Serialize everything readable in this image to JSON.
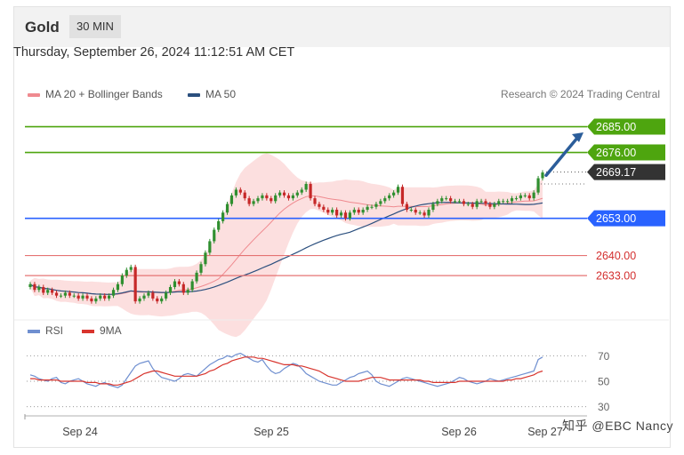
{
  "header": {
    "asset": "Gold",
    "timeframe": "30 MIN"
  },
  "datetime": "Thursday, September 26, 2024 11:12:51 AM CET",
  "legend": [
    {
      "label": "MA 20 + Bollinger Bands",
      "color": "#ef8a8f"
    },
    {
      "label": "MA 50",
      "color": "#2b4f7e"
    }
  ],
  "credit": "Research © 2024 Trading Central",
  "rsi_legend": [
    {
      "label": "RSI",
      "color": "#6f8fd0"
    },
    {
      "label": "9MA",
      "color": "#d8342d"
    }
  ],
  "watermark": "知乎 @EBC Nancy",
  "colors": {
    "up": "#2f8f2f",
    "down": "#c62828",
    "resistance": "#4ea50f",
    "pivot": "#2962ff",
    "support": "#e57373",
    "last": "#333333"
  },
  "chart_data": [
    {
      "type": "candlestick",
      "title": "Gold",
      "timeframe": "30 MIN",
      "ylim": [
        2620,
        2692
      ],
      "x_ticks": [
        "Sep 24",
        "Sep 25",
        "Sep 26",
        "Sep 27"
      ],
      "last_price": 2669.17,
      "levels": [
        {
          "label": "2685.00",
          "value": 2685,
          "kind": "resistance"
        },
        {
          "label": "2676.00",
          "value": 2676,
          "kind": "resistance"
        },
        {
          "label": "2653.00",
          "value": 2653,
          "kind": "pivot"
        },
        {
          "label": "2640.00",
          "value": 2640,
          "kind": "support"
        },
        {
          "label": "2633.00",
          "value": 2633,
          "kind": "support"
        }
      ],
      "last_label": "2669.17",
      "projection": {
        "from": 2668,
        "to": 2683
      },
      "close": [
        2630,
        2628,
        2629,
        2627,
        2628,
        2627,
        2626,
        2626,
        2627,
        2626,
        2626,
        2625,
        2626,
        2625,
        2624,
        2625,
        2626,
        2625,
        2626,
        2628,
        2630,
        2633,
        2635,
        2636,
        2624,
        2625,
        2626,
        2627,
        2625,
        2624,
        2625,
        2627,
        2629,
        2631,
        2630,
        2627,
        2628,
        2631,
        2634,
        2637,
        2641,
        2645,
        2649,
        2652,
        2655,
        2658,
        2661,
        2663,
        2662,
        2660,
        2658,
        2659,
        2660,
        2661,
        2660,
        2659,
        2661,
        2662,
        2661,
        2660,
        2661,
        2662,
        2663,
        2665,
        2660,
        2658,
        2657,
        2656,
        2655,
        2656,
        2654,
        2655,
        2653,
        2655,
        2656,
        2655,
        2656,
        2657,
        2657,
        2658,
        2659,
        2660,
        2661,
        2662,
        2664,
        2658,
        2656,
        2656,
        2655,
        2655,
        2654,
        2656,
        2658,
        2659,
        2660,
        2660,
        2659,
        2659,
        2659,
        2658,
        2658,
        2657,
        2659,
        2659,
        2658,
        2657,
        2658,
        2659,
        2659,
        2659,
        2660,
        2660,
        2661,
        2661,
        2660,
        2662,
        2667,
        2669
      ]
    },
    {
      "type": "line",
      "title": "RSI",
      "ylim": [
        20,
        80
      ],
      "y_ticks": [
        70,
        50,
        30
      ],
      "series": [
        {
          "name": "RSI",
          "values": [
            55,
            54,
            52,
            51,
            50,
            52,
            53,
            49,
            48,
            50,
            51,
            52,
            50,
            48,
            47,
            46,
            48,
            49,
            47,
            46,
            45,
            47,
            52,
            57,
            62,
            64,
            65,
            66,
            60,
            56,
            53,
            52,
            51,
            50,
            52,
            55,
            56,
            55,
            54,
            57,
            60,
            63,
            65,
            67,
            68,
            70,
            69,
            71,
            72,
            70,
            68,
            66,
            65,
            67,
            62,
            58,
            56,
            57,
            60,
            62,
            64,
            63,
            60,
            56,
            54,
            52,
            50,
            49,
            48,
            47,
            47,
            49,
            51,
            53,
            54,
            56,
            57,
            58,
            55,
            50,
            48,
            47,
            46,
            48,
            50,
            52,
            53,
            52,
            51,
            50,
            49,
            48,
            47,
            46,
            47,
            48,
            49,
            51,
            53,
            52,
            50,
            49,
            48,
            49,
            50,
            52,
            51,
            50,
            51,
            52,
            53,
            54,
            55,
            56,
            57,
            58,
            67,
            69
          ]
        },
        {
          "name": "9MA",
          "values": [
            52,
            52,
            51,
            51,
            51,
            51,
            51,
            50,
            50,
            50,
            50,
            50,
            50,
            49,
            49,
            49,
            48,
            48,
            48,
            47,
            47,
            48,
            49,
            50,
            52,
            54,
            56,
            57,
            58,
            58,
            57,
            56,
            55,
            54,
            54,
            54,
            54,
            54,
            54,
            55,
            56,
            58,
            59,
            61,
            63,
            64,
            66,
            67,
            68,
            69,
            69,
            69,
            68,
            68,
            67,
            66,
            65,
            64,
            63,
            63,
            63,
            62,
            62,
            61,
            60,
            59,
            58,
            56,
            54,
            53,
            52,
            51,
            50,
            50,
            50,
            50,
            51,
            52,
            53,
            53,
            53,
            52,
            51,
            51,
            51,
            51,
            51,
            51,
            51,
            51,
            50,
            50,
            49,
            49,
            49,
            49,
            49,
            49,
            50,
            50,
            50,
            50,
            50,
            50,
            50,
            50,
            50,
            50,
            50,
            51,
            51,
            52,
            52,
            53,
            54,
            55,
            57,
            58
          ]
        }
      ]
    }
  ]
}
